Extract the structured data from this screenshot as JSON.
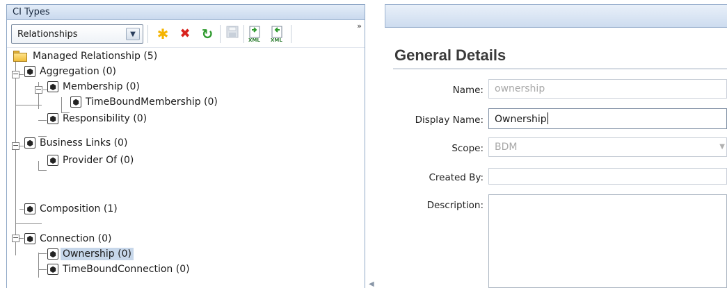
{
  "left_panel": {
    "title": "CI Types",
    "dropdown": {
      "selected": "Relationships",
      "arrow_icon": "chevron-down-icon"
    },
    "toolbar_buttons": [
      {
        "name": "new-button",
        "icon": "asterisk-icon",
        "glyph": "✱",
        "color": "#f5b400"
      },
      {
        "name": "delete-button",
        "icon": "red-x-icon",
        "glyph": "✖",
        "color": "#d8231e"
      },
      {
        "name": "refresh-button",
        "icon": "refresh-icon",
        "glyph": "↻",
        "color": "#2e9a2e"
      },
      {
        "name": "save-button",
        "icon": "floppy-icon",
        "glyph": "▣",
        "color": "#b8c1cc"
      },
      {
        "name": "export-xml-button",
        "icon": "xml-export-icon",
        "glyph": "XML",
        "color": "#2e7d32"
      },
      {
        "name": "import-xml-button",
        "icon": "xml-import-icon",
        "glyph": "XML",
        "color": "#2e7d32"
      }
    ],
    "more_label": "»",
    "tree": {
      "root": "Managed Relationship (5)",
      "nodes": [
        {
          "label": "Aggregation (0)"
        },
        {
          "label": "Membership (0)"
        },
        {
          "label": "TimeBoundMembership (0)"
        },
        {
          "label": "Responsibility (0)"
        },
        {
          "label": "Business Links (0)"
        },
        {
          "label": "Provider Of (0)"
        },
        {
          "label": "Composition (1)"
        },
        {
          "label": "Connection (0)"
        },
        {
          "label": "Ownership (0)"
        },
        {
          "label": "TimeBoundConnection (0)"
        }
      ],
      "selected": "Ownership (0)"
    }
  },
  "right_panel": {
    "section_title": "General Details",
    "fields": {
      "name": {
        "label": "Name:",
        "value": "ownership"
      },
      "display_name": {
        "label": "Display Name:",
        "value": "Ownership"
      },
      "scope": {
        "label": "Scope:",
        "value": "BDM"
      },
      "created_by": {
        "label": "Created By:",
        "value": ""
      },
      "description": {
        "label": "Description:",
        "value": ""
      }
    }
  },
  "colors": {
    "selection": "#c7d7ea",
    "header_gradient_top": "#e4edf8",
    "header_gradient_bottom": "#c9d9ee"
  }
}
